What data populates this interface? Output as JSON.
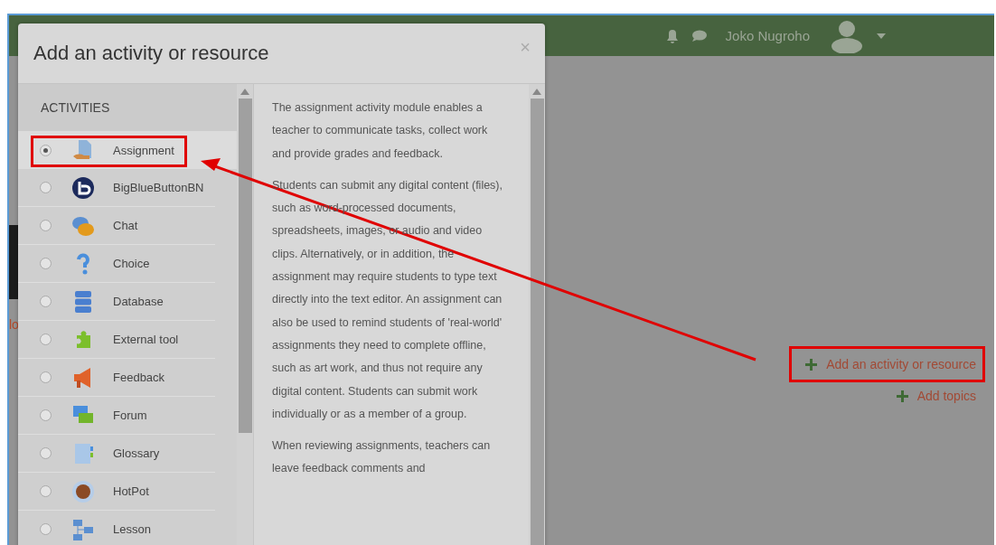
{
  "header": {
    "user_name": "Joko Nugroho"
  },
  "page": {
    "fragment": "lo",
    "links": [
      {
        "label": "Add an activity or resource",
        "highlighted": true
      },
      {
        "label": "Add topics",
        "highlighted": false
      }
    ]
  },
  "dialog": {
    "title": "Add an activity or resource",
    "close": "×",
    "section": "ACTIVITIES",
    "items": [
      {
        "label": "Assignment",
        "selected": true
      },
      {
        "label": "BigBlueButtonBN",
        "selected": false
      },
      {
        "label": "Chat",
        "selected": false
      },
      {
        "label": "Choice",
        "selected": false
      },
      {
        "label": "Database",
        "selected": false
      },
      {
        "label": "External tool",
        "selected": false
      },
      {
        "label": "Feedback",
        "selected": false
      },
      {
        "label": "Forum",
        "selected": false
      },
      {
        "label": "Glossary",
        "selected": false
      },
      {
        "label": "HotPot",
        "selected": false
      },
      {
        "label": "Lesson",
        "selected": false
      }
    ],
    "description": [
      "The assignment activity module enables a teacher to communicate tasks, collect work and provide grades and feedback.",
      "Students can submit any digital content (files), such as word-processed documents, spreadsheets, images, or audio and video clips. Alternatively, or in addition, the assignment may require students to type text directly into the text editor. An assignment can also be used to remind students of 'real-world' assignments they need to complete offline, such as art work, and thus not require any digital content. Students can submit work individually or as a member of a group.",
      "When reviewing assignments, teachers can leave feedback comments and"
    ]
  }
}
